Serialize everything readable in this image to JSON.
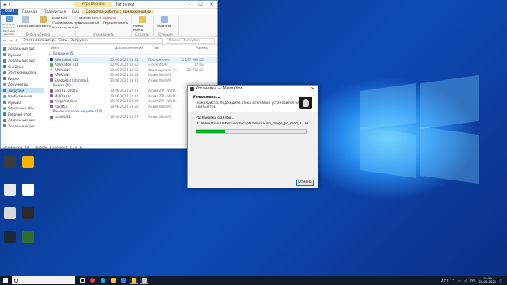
{
  "explorer": {
    "manage_label": "Управление",
    "title": "Загрузки",
    "tabs": [
      "Файл",
      "Главная",
      "Поделиться",
      "Вид",
      "Средства работы с приложениями"
    ],
    "ribbon": {
      "pin_label": "Закрепить на панели быстрого доступа",
      "copy_label": "Копировать",
      "paste_label": "Вставить",
      "cut_label": "Вырезать",
      "copy_path_label": "Скопировать путь",
      "paste_shortcut_label": "Вставить ярлык",
      "clipboard_group": "Буфер обмена",
      "move_to_label": "Переместить в",
      "copy_to_label": "Копировать в",
      "delete_label": "Удалить",
      "rename_label": "Переименовать",
      "organize_group": "Упорядочить",
      "new_folder_label": "Новая папка",
      "create_group": "Создать",
      "properties_label": "Свойства",
      "open_group": "Открыть"
    },
    "address": "Этот компьютер › Сеть › Загрузки",
    "search_placeholder": "Поиск: Загрузки",
    "nav_items": [
      {
        "label": "Локальный дис",
        "color": "#6b7b8c"
      },
      {
        "label": "Музыка",
        "color": "#4c87d6"
      },
      {
        "label": "Локальный дис",
        "color": "#6b7b8c"
      },
      {
        "label": "OneDrive",
        "color": "#2d7be0"
      },
      {
        "label": "Этот компьютер",
        "color": "#5f7ca6"
      },
      {
        "label": "Видео",
        "color": "#6f5fb8"
      },
      {
        "label": "Документы",
        "color": "#8a8fa0"
      },
      {
        "label": "Загрузки",
        "color": "#2d7be0"
      },
      {
        "label": "Изображения",
        "color": "#4fa5d8"
      },
      {
        "label": "Музыка",
        "color": "#4c87d6"
      },
      {
        "label": "Объемные объ",
        "color": "#5bb6d6"
      },
      {
        "label": "Рабочий стол",
        "color": "#3f7fd0"
      },
      {
        "label": "Локальный дис",
        "color": "#6b7b8c"
      },
      {
        "label": "Локальный дис",
        "color": "#6b7b8c"
      }
    ],
    "columns": {
      "name": "Имя",
      "date": "Дата изменения",
      "type": "Тип",
      "size": "Размер"
    },
    "groups": [
      {
        "label": "Сегодня (5)",
        "files": [
          {
            "name": "Allemation v16",
            "date": "20.06.2021 13:51",
            "type": "Приложение",
            "size": "1 197 999 КБ",
            "color": "#2c2c2c"
          },
          {
            "name": "Allemation v16",
            "date": "20.06.2021 13:52",
            "type": "uTorrent URI",
            "size": "17 КБ",
            "color": "#56a84b"
          },
          {
            "name": "ARIALUNI",
            "date": "20.06.2021 13:52",
            "type": "Файл шрифта Tr...",
            "size": "22 731 КБ",
            "color": "#d9d9d9"
          },
          {
            "name": "ARIALUNI",
            "date": "20.06.2021 13:52",
            "type": "Архив WinRAR",
            "size": "",
            "color": "#8a5a9e"
          },
          {
            "name": "SangoAsia Ultimate 1",
            "date": "20.06.2021 13:31",
            "type": "Архив WinRAR",
            "size": "",
            "color": "#8a5a9e"
          }
        ]
      },
      {
        "label": "Вчера (4)",
        "files": [
          {
            "name": "patch1108021",
            "date": "19.06.2021 22:31",
            "type": "Архив ZIP - WinR...",
            "size": "",
            "color": "#8a5a9e"
          },
          {
            "name": "MuKaapar",
            "date": "19.06.2021 22:31",
            "type": "Архив ZIP - WinR...",
            "size": "",
            "color": "#8a5a9e"
          },
          {
            "name": "KingdAsonline",
            "date": "19.06.2021 22:00",
            "type": "Архив ZIP - WinR...",
            "size": "",
            "color": "#8a5a9e"
          },
          {
            "name": "RaidMu",
            "date": "19.06.2021 20:50",
            "type": "Архив WinRAR",
            "size": "",
            "color": "#8a5a9e"
          }
        ]
      },
      {
        "label": "Ранее на этой неделе (10)",
        "files": [
          {
            "name": "LostMU53",
            "date": "16.06.2021 18:47",
            "type": "Архив WinRAR",
            "size": "",
            "color": "#8a5a9e"
          }
        ]
      }
    ],
    "status": {
      "count": "Элементов: 29",
      "selected": "Выбран 1 элемент: 1,33 ГБ"
    }
  },
  "installer": {
    "title": "Установка — Allemation",
    "header_title": "Установка...",
    "header_subtitle": "Пожалуйста, подождите, пока Allemation установится на ваш компьютер.",
    "status_text": "Распаковка файлов...",
    "file_path": "D:\\Allemation\\Data\\Client\\Scripts\\allemation_mage_pd_mod_1.CPI",
    "progress": 0.26,
    "cancel_label": "Отмена"
  },
  "desktop_icons": [
    {
      "label": "",
      "color": "#3b3b3b"
    },
    {
      "label": "",
      "color": "#f5b400"
    },
    {
      "label": "",
      "color": "#e8e8e8"
    },
    {
      "label": "",
      "color": "#ffffff"
    },
    {
      "label": "",
      "color": "#d9d9d9"
    },
    {
      "label": "",
      "color": "#2a2a2a"
    },
    {
      "label": "",
      "color": "#1b2838"
    },
    {
      "label": "",
      "color": "#2f6e2f"
    }
  ],
  "taskbar": {
    "search_placeholder": "",
    "weather": "23°C",
    "time": "15:59",
    "date": "20.06.2021"
  }
}
